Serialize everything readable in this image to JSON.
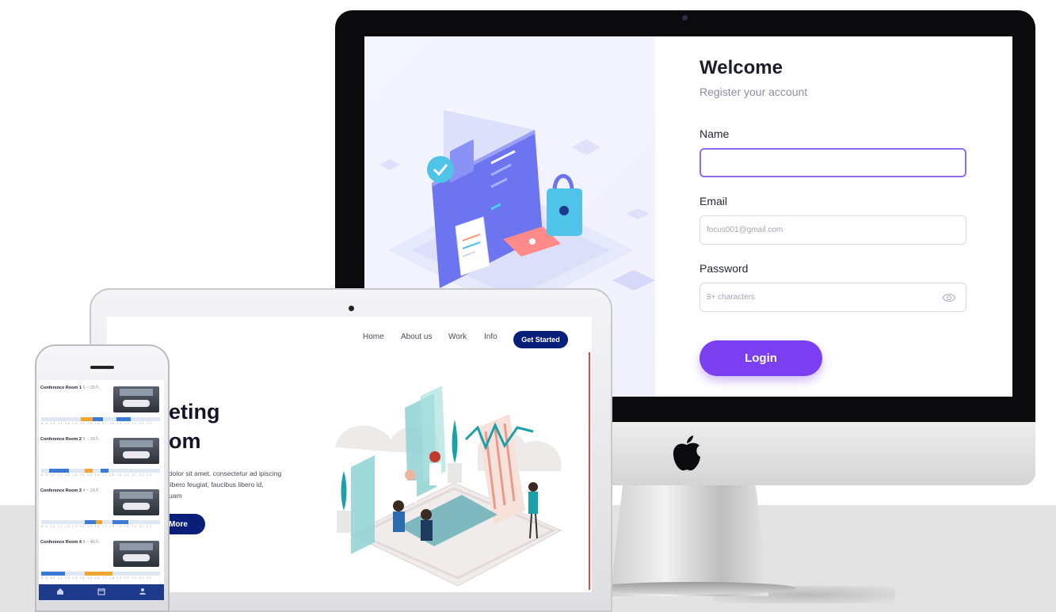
{
  "desktop": {
    "title": "Welcome",
    "subtitle": "Register your account",
    "name_label": "Name",
    "email_label": "Email",
    "email_placeholder": "focus001@gmail.com",
    "password_label": "Password",
    "password_placeholder": "8+ characters",
    "login_label": "Login"
  },
  "tablet": {
    "nav": [
      "Home",
      "About us",
      "Work",
      "Info"
    ],
    "cta_label": "Get Started",
    "hero_line1": "eting",
    "hero_line2": "om",
    "body_line1": "dolor sit amet. consectetur ad ipiscing",
    "body_line2": "libero feugiat, faucibus libero id,",
    "body_line3": "uam",
    "more_label": "More"
  },
  "phone": {
    "rooms": [
      {
        "title": "Conference Room 1",
        "capacity": "6 ~ 20人"
      },
      {
        "title": "Conference Room 2",
        "capacity": "5 ~ 20人"
      },
      {
        "title": "Conference Room 3",
        "capacity": "4 ~ 20人"
      },
      {
        "title": "Conference Room 4",
        "capacity": "8 ~ 40人"
      }
    ],
    "hours": "8 9 10 11 12 13 14 15 16 17 18 19 20 21 22 23"
  },
  "colors": {
    "accent_purple": "#7b3ff2",
    "navy": "#0a1f7a",
    "booked_blue": "#3a7bd5",
    "booked_orange": "#f2a531",
    "tabbar": "#1e3a8a"
  }
}
